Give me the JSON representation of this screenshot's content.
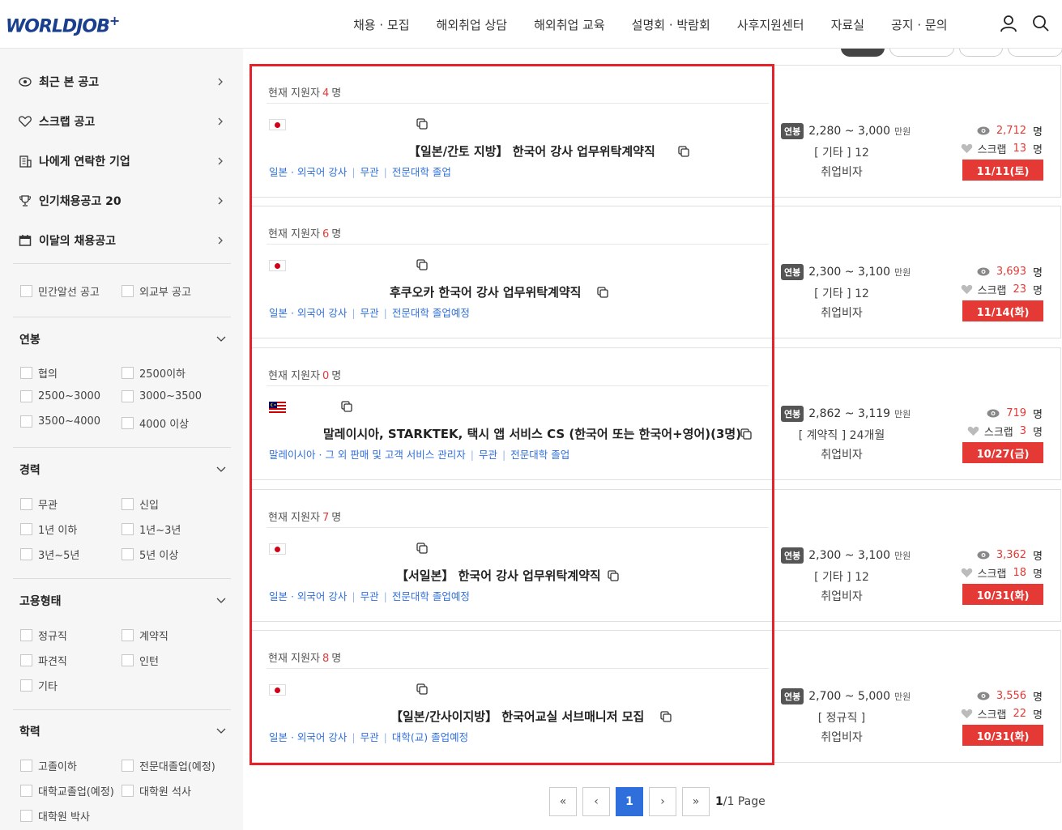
{
  "header": {
    "logo": "WORLDJOB",
    "logo_plus": "+",
    "nav": [
      "채용 · 모집",
      "해외취업 상담",
      "해외취업 교육",
      "설명회 · 박람회",
      "사후지원센터",
      "자료실",
      "공지 · 문의"
    ]
  },
  "sidebar": {
    "menu": [
      "최근 본 공고",
      "스크랩 공고",
      "나에게 연락한 기업",
      "인기채용공고 20",
      "이달의 채용공고"
    ],
    "source_filters": [
      "민간알선 공고",
      "외교부 공고"
    ],
    "sections": [
      {
        "title": "연봉",
        "options": [
          "협의",
          "2500이하",
          "2500~3000",
          "3000~3500",
          "3500~4000",
          "4000 이상"
        ]
      },
      {
        "title": "경력",
        "options": [
          "무관",
          "신입",
          "1년 이하",
          "1년~3년",
          "3년~5년",
          "5년 이상"
        ]
      },
      {
        "title": "고용형태",
        "options": [
          "정규직",
          "계약직",
          "파견직",
          "인턴",
          "기타"
        ]
      },
      {
        "title": "학력",
        "options": [
          "고졸이하",
          "전문대졸업(예정)",
          "대학교졸업(예정)",
          "대학원 석사",
          "대학원 박사"
        ]
      }
    ]
  },
  "jobs": [
    {
      "applicants_label": "현재 지원자",
      "applicants": "4",
      "applicants_unit": "명",
      "flag": "japan",
      "title": "【일본/간토 지방】  한국어 강사 업무위탁계약직",
      "tags": [
        "일본 · 외국어 강사",
        "무관",
        "전문대학 졸업"
      ],
      "salary_badge": "연봉",
      "salary": "2,280 ~ 3,000",
      "salary_unit": "만원",
      "term": "[ 기타 ] 12",
      "visa": "취업비자",
      "views": "2,712",
      "views_unit": "명",
      "scrap_label": "스크랩",
      "scraps": "13",
      "scrap_unit": "명",
      "deadline": "11/11(토)"
    },
    {
      "applicants_label": "현재 지원자",
      "applicants": "6",
      "applicants_unit": "명",
      "flag": "japan",
      "title": "후쿠오카 한국어 강사 업무위탁계약직",
      "tags": [
        "일본 · 외국어 강사",
        "무관",
        "전문대학 졸업예정"
      ],
      "salary_badge": "연봉",
      "salary": "2,300 ~ 3,100",
      "salary_unit": "만원",
      "term": "[ 기타 ] 12",
      "visa": "취업비자",
      "views": "3,693",
      "views_unit": "명",
      "scrap_label": "스크랩",
      "scraps": "23",
      "scrap_unit": "명",
      "deadline": "11/14(화)"
    },
    {
      "applicants_label": "현재 지원자",
      "applicants": "0",
      "applicants_unit": "명",
      "flag": "malaysia",
      "title": "말레이시아, STARKTEK, 택시 앱 서비스 CS (한국어 또는 한국어+영어)(3명)",
      "tags": [
        "말레이시아 · 그 외 판매 및 고객 서비스 관리자",
        "무관",
        "전문대학 졸업"
      ],
      "salary_badge": "연봉",
      "salary": "2,862 ~ 3,119",
      "salary_unit": "만원",
      "term": "[ 계약직 ] 24개월",
      "visa": "취업비자",
      "views": "719",
      "views_unit": "명",
      "scrap_label": "스크랩",
      "scraps": "3",
      "scrap_unit": "명",
      "deadline": "10/27(금)"
    },
    {
      "applicants_label": "현재 지원자",
      "applicants": "7",
      "applicants_unit": "명",
      "flag": "japan",
      "title": "【서일본】 한국어 강사 업무위탁계약직",
      "tags": [
        "일본 · 외국어 강사",
        "무관",
        "전문대학 졸업예정"
      ],
      "salary_badge": "연봉",
      "salary": "2,300 ~ 3,100",
      "salary_unit": "만원",
      "term": "[ 기타 ] 12",
      "visa": "취업비자",
      "views": "3,362",
      "views_unit": "명",
      "scrap_label": "스크랩",
      "scraps": "18",
      "scrap_unit": "명",
      "deadline": "10/31(화)"
    },
    {
      "applicants_label": "현재 지원자",
      "applicants": "8",
      "applicants_unit": "명",
      "flag": "japan",
      "title": "【일본/간사이지방】 한국어교실 서브매니저 모집",
      "tags": [
        "일본 · 외국어 강사",
        "무관",
        "대학(교) 졸업예정"
      ],
      "salary_badge": "연봉",
      "salary": "2,700 ~ 5,000",
      "salary_unit": "만원",
      "term": "[ 정규직 ]",
      "visa": "취업비자",
      "views": "3,556",
      "views_unit": "명",
      "scrap_label": "스크랩",
      "scraps": "22",
      "scrap_unit": "명",
      "deadline": "10/31(화)"
    }
  ],
  "pagination": {
    "first": "«",
    "prev": "‹",
    "current": "1",
    "next": "›",
    "last": "»",
    "page_current": "1",
    "page_total": "/1 Page"
  },
  "colors": {
    "accent": "#2f6fdb",
    "highlight": "#e8202a",
    "deadline": "#e53935"
  }
}
